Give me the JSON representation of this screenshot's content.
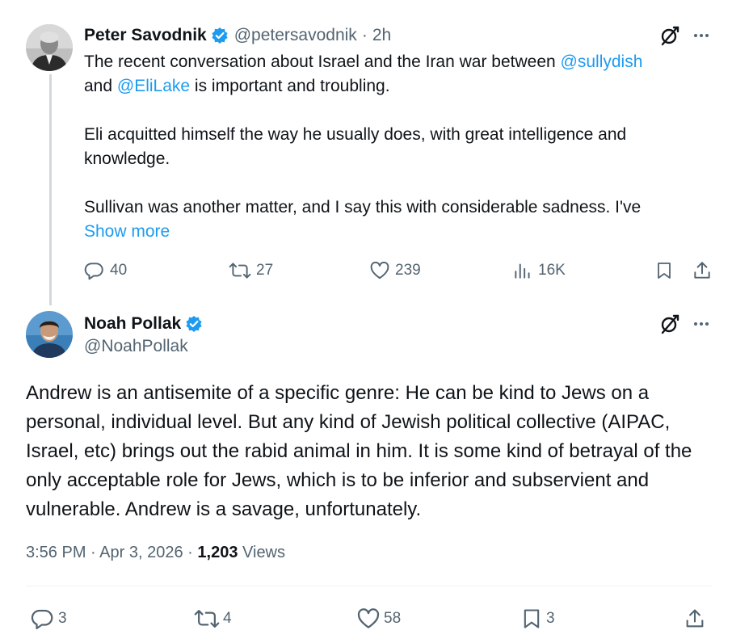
{
  "reply_to": {
    "author_name": "Peter Savodnik",
    "handle": "@petersavodnik",
    "separator": "·",
    "time": "2h",
    "text_line1_pre": "The recent conversation about Israel and the Iran war between ",
    "mention1": "@sullydish",
    "text_line2_pre": "and ",
    "mention2": "@EliLake",
    "text_line2_post": " is important and troubling.",
    "para2": "Eli acquitted himself the way he usually does, with great intelligence and knowledge.",
    "para3": "Sullivan was another matter, and I say this with considerable sadness. I've",
    "show_more": "Show more",
    "stats": {
      "replies": "40",
      "reposts": "27",
      "likes": "239",
      "views": "16K"
    }
  },
  "main_tweet": {
    "author_name": "Noah Pollak",
    "handle": "@NoahPollak",
    "text": "Andrew is an antisemite of a specific genre: He can be kind to Jews on a personal, individual level. But any kind of Jewish political collective (AIPAC, Israel, etc) brings out the rabid animal in him. It is some kind of betrayal of the only acceptable role for Jews, which is to be inferior and subservient and vulnerable. Andrew is a savage, unfortunately.",
    "time": "3:56 PM",
    "sep1": "·",
    "date": "Apr 3, 2026",
    "sep2": "·",
    "views_count": "1,203",
    "views_label": "Views",
    "stats": {
      "replies": "3",
      "reposts": "4",
      "likes": "58",
      "bookmarks": "3"
    }
  },
  "colors": {
    "accent": "#1d9bf0",
    "text": "#0f1419",
    "secondary": "#536471",
    "thread_line": "#cfd9de"
  },
  "icons": [
    "verified-badge-icon",
    "grok-icon",
    "more-icon",
    "reply-icon",
    "repost-icon",
    "like-icon",
    "views-icon",
    "bookmark-icon",
    "share-icon"
  ]
}
